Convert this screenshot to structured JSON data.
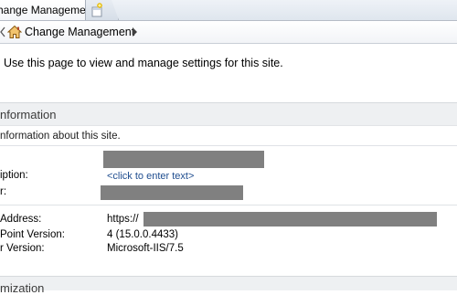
{
  "tabs": [
    {
      "label": "hange Management"
    }
  ],
  "breadcrumb": {
    "label": "Change Management"
  },
  "intro_text": "Use this page to view and manage settings for this site.",
  "information_section": {
    "title": "nformation",
    "description": "nformation about this site.",
    "rows": [
      {
        "label": "iption:",
        "value": "<click to enter text>"
      },
      {
        "label": "r:",
        "value": ""
      },
      {
        "label": "Address:",
        "value": "https://"
      },
      {
        "label": "Point Version:",
        "value": "4 (15.0.0.4433)"
      },
      {
        "label": "r Version:",
        "value": "Microsoft-IIS/7.5"
      }
    ]
  },
  "customization_section": {
    "title": "mization"
  },
  "colors": {
    "link": "#1f4d8f",
    "redaction": "#808080",
    "section_bg": "#eef0f2"
  },
  "icons": [
    "new-tab-icon",
    "home-icon",
    "chevron-right-icon"
  ]
}
